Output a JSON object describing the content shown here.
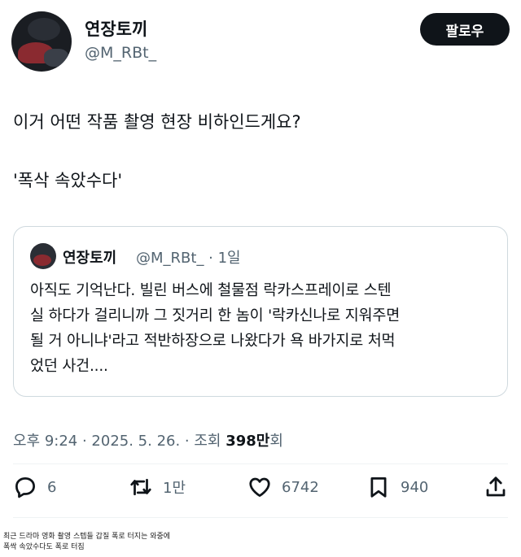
{
  "author": {
    "name": "연장토끼",
    "handle": "@M_RBt_"
  },
  "follow_label": "팔로우",
  "tweet": {
    "line1": "이거 어떤 작품 촬영 현장 비하인드게요?",
    "line2": "'폭삭 속았수다'"
  },
  "quote": {
    "name": "연장토끼",
    "handle_time": "@M_RBt_ · 1일",
    "lines": [
      "아직도 기억난다. 빌린 버스에 철물점 락카스프레이로 스텐",
      "실 하다가 걸리니까 그 짓거리 한 놈이 '락카신나로 지워주면",
      "될 거 아니냐'라고 적반하장으로 나왔다가 욕 바가지로 처먹",
      "었던 사건...."
    ]
  },
  "meta": {
    "time_date": "오후 9:24 · 2025. 5. 26. · 조회 ",
    "views": "398만",
    "views_suffix": "회"
  },
  "actions": {
    "replies": "6",
    "retweets": "1만",
    "likes": "6742",
    "bookmarks": "940"
  },
  "caption": {
    "line1": "최근 드라마 영화 촬영 스텝들 갑질 폭로 터지는 와중에",
    "line2": "폭싹 속았수다도 폭로 터짐"
  }
}
